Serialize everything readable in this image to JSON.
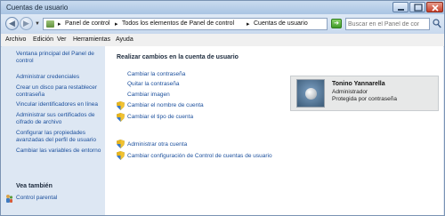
{
  "window": {
    "title": "Cuentas de usuario"
  },
  "address": {
    "crumbs": [
      "Panel de control",
      "Todos los elementos de Panel de control",
      "Cuentas de usuario"
    ],
    "separator": "▸"
  },
  "search": {
    "placeholder": "Buscar en el Panel de control"
  },
  "menu": [
    "Archivo",
    "Edición",
    "Ver",
    "Herramientas",
    "Ayuda"
  ],
  "sidebar": {
    "links": [
      {
        "line1": "Ventana principal del Panel de",
        "line2": "control"
      },
      {
        "line1": "Administrar credenciales",
        "line2": ""
      },
      {
        "line1": "Crear un disco para restablecer",
        "line2": "contraseña"
      },
      {
        "line1": "Vincular identificadores en línea",
        "line2": ""
      },
      {
        "line1": "Administrar sus certificados de",
        "line2": "cifrado de archivo"
      },
      {
        "line1": "Configurar las propiedades",
        "line2": "avanzadas del perfil de usuario"
      },
      {
        "line1": "Cambiar las variables de entorno",
        "line2": ""
      }
    ],
    "see_also_title": "Vea también",
    "see_also": [
      "Control parental"
    ]
  },
  "main": {
    "heading": "Realizar cambios en la cuenta de usuario",
    "tasks": [
      {
        "label": "Cambiar la contraseña",
        "shield": false
      },
      {
        "label": "Quitar la contraseña",
        "shield": false
      },
      {
        "label": "Cambiar imagen",
        "shield": false
      },
      {
        "label": "Cambiar el nombre de cuenta",
        "shield": true
      },
      {
        "label": "Cambiar el tipo de cuenta",
        "shield": true
      }
    ],
    "more_tasks": [
      {
        "label": "Administrar otra cuenta",
        "shield": true
      },
      {
        "label": "Cambiar configuración de Control de cuentas de usuario",
        "shield": true
      }
    ]
  },
  "user": {
    "name": "Tonino Yannarella",
    "role": "Administrador",
    "protection": "Protegida por contraseña"
  },
  "colors": {
    "link": "#1b4f9c",
    "sidebar_bg": "#dde7f3",
    "main_bg": "#ffffff"
  }
}
